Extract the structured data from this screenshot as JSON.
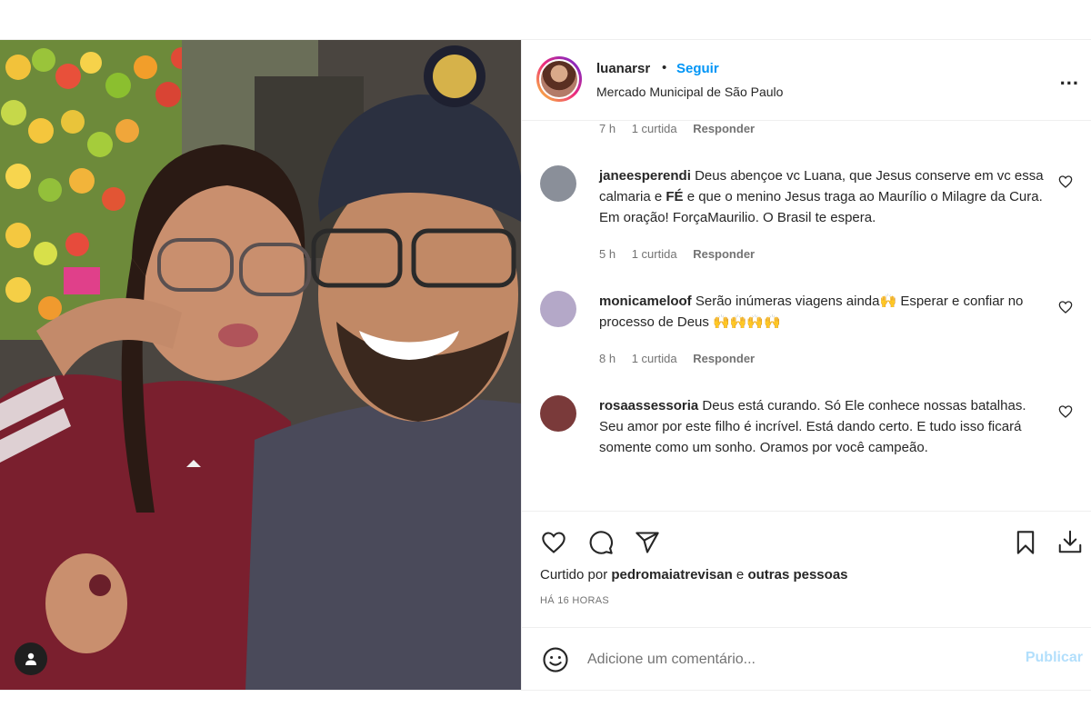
{
  "header": {
    "username": "luanarsr",
    "separator": "•",
    "follow_label": "Seguir",
    "location": "Mercado Municipal de São Paulo",
    "more_label": "..."
  },
  "top_meta": {
    "time": "7 h",
    "likes": "1 curtida",
    "reply": "Responder"
  },
  "comments": [
    {
      "username": "janeesperendi",
      "text_before": "Deus abençoe vc Luana, que Jesus conserve em vc essa calmaria e ",
      "text_bold": "FÉ",
      "text_after": " e que o menino Jesus traga ao Maurílio o Milagre da Cura. Em oração! ForçaMaurilio. O Brasil te espera.",
      "time": "5 h",
      "likes": "1 curtida",
      "reply": "Responder",
      "avatar_color": "#8a8f99"
    },
    {
      "username": "monicameloof",
      "text": "Serão inúmeras viagens ainda🙌 Esperar e confiar no processo de Deus 🙌🙌🙌🙌",
      "time": "8 h",
      "likes": "1 curtida",
      "reply": "Responder",
      "avatar_color": "#b4a8c8"
    },
    {
      "username": "rosaassessoria",
      "text": "Deus está curando. Só Ele conhece nossas batalhas. Seu amor por este filho é incrível. Está dando certo. E tudo isso ficará somente como um sonho. Oramos por você campeão.",
      "avatar_color": "#7a3a3a"
    }
  ],
  "likes_line": {
    "prefix": "Curtido por ",
    "user": "pedromaiatrevisan",
    "and": " e ",
    "others": "outras pessoas"
  },
  "time_ago": "HÁ 16 HORAS",
  "add_comment": {
    "placeholder": "Adicione um comentário...",
    "publish_label": "Publicar"
  },
  "colors": {
    "link_blue": "#0095f6",
    "publish_disabled": "#b2dffc",
    "muted": "#737373"
  }
}
